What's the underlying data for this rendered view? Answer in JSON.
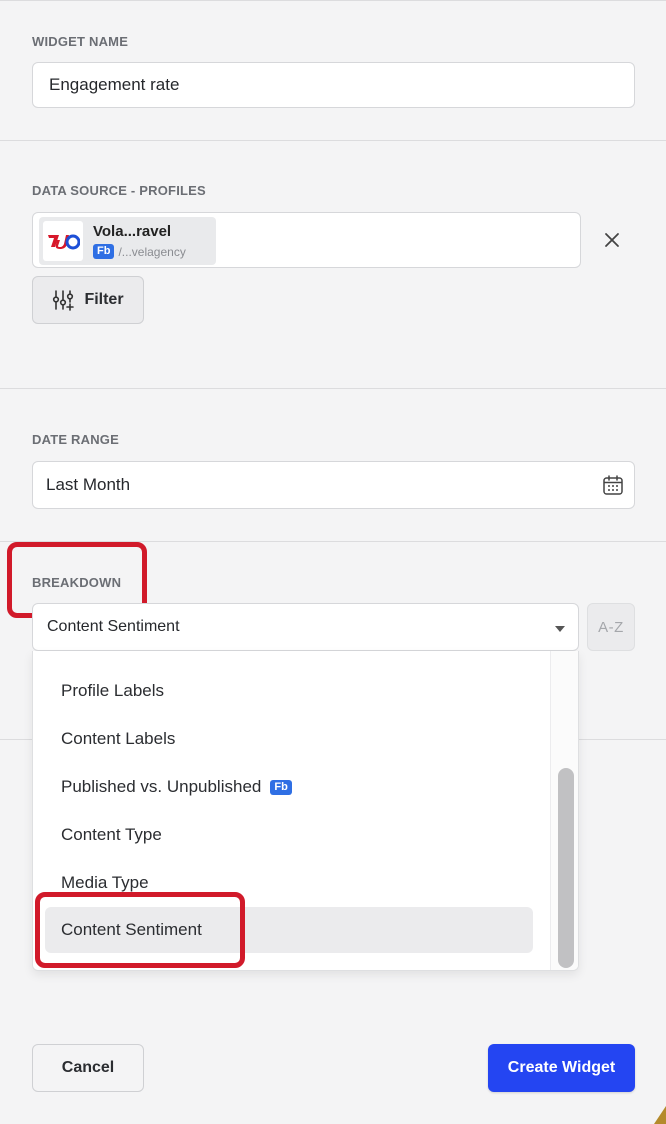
{
  "widget_name": {
    "label": "WIDGET NAME",
    "value": "Engagement rate"
  },
  "data_source": {
    "label": "DATA SOURCE - PROFILES",
    "profile": {
      "name": "Vola...ravel",
      "network_badge": "Fb",
      "handle": "/...velagency",
      "logo_text": "UO"
    },
    "remove_icon": "close-icon",
    "filter_button": "Filter",
    "filter_icon": "sliders-icon"
  },
  "date_range": {
    "label": "DATE RANGE",
    "value": "Last Month",
    "icon": "calendar-icon"
  },
  "breakdown": {
    "label": "BREAKDOWN",
    "selected": "Content Sentiment",
    "sort_button": "A-Z",
    "options": [
      {
        "label": "Profile Labels",
        "badge": ""
      },
      {
        "label": "Content Labels",
        "badge": ""
      },
      {
        "label": "Published vs. Unpublished",
        "badge": "Fb"
      },
      {
        "label": "Content Type",
        "badge": ""
      },
      {
        "label": "Media Type",
        "badge": ""
      },
      {
        "label": "Content Sentiment",
        "badge": "",
        "active": true
      }
    ]
  },
  "footer": {
    "cancel": "Cancel",
    "create": "Create Widget"
  },
  "colors": {
    "primary": "#2445f2",
    "highlight": "#d11a2a",
    "fb_badge": "#2f6fe4",
    "background": "#f4f4f5"
  }
}
